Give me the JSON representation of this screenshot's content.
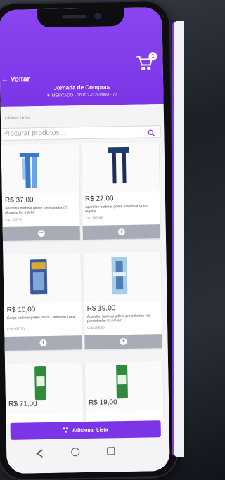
{
  "header": {
    "back_label": "Voltar",
    "title": "Jornada de Compras",
    "subtitle": "▼ MERCADO - 30 0' 2-2-2/3/000 - 77",
    "cart_count": "1"
  },
  "filter": {
    "label": "Ofertas Linha"
  },
  "search": {
    "placeholder": "Procurar produtos..."
  },
  "products": [
    {
      "price": "R$ 37,00",
      "description": "Aparelho barbear gillete prestobarba c/3 ultragrip bic mach3",
      "code": "Cod 183700"
    },
    {
      "price": "R$ 27,00",
      "description": "Aparelho barbear gillete prestobarba c/2 regular",
      "code": "Cod 183746"
    },
    {
      "price": "R$ 10,00",
      "description": "Carga barbear gillete mach3 sensitive 1und.",
      "code": "Cod 183710"
    },
    {
      "price": "R$ 19,00",
      "description": "Aparelho barbear gillete prestobarba c/2 prestobarba 3 cool arr",
      "code": "Cod 183690"
    },
    {
      "price": "R$ 71,00"
    },
    {
      "price": "R$ 19,00"
    }
  ],
  "footer": {
    "add_list_label": "Adicionar Lista"
  },
  "colors": {
    "primary": "#7c35e6",
    "add_button": "#a9acb6"
  }
}
